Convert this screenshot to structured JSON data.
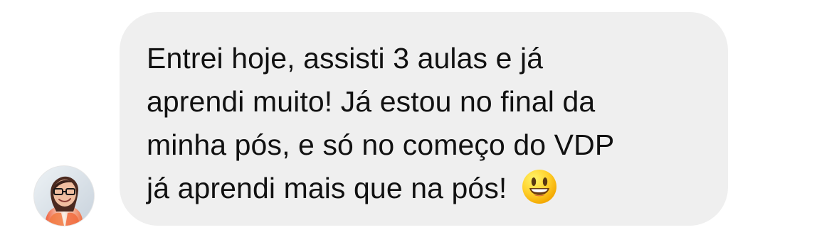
{
  "message": {
    "lines": [
      "Entrei hoje, assisti 3 aulas e já",
      "aprendi muito! Já estou no final da",
      "minha pós, e só no começo do VDP",
      "já aprendi mais que na pós!"
    ],
    "emoji": "smiling-face-icon"
  },
  "avatar": {
    "icon": "profile-photo-icon"
  },
  "colors": {
    "bubble_background": "#efefef",
    "text": "#111111",
    "page_background": "#ffffff"
  }
}
